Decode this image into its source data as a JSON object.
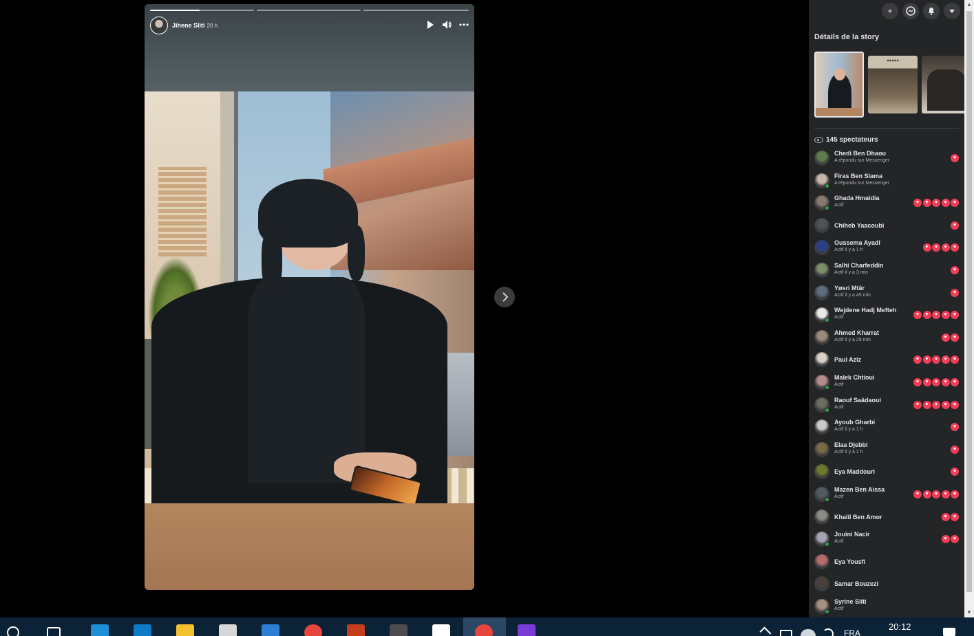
{
  "story": {
    "author": "Jihene Sliti",
    "time": "20 h",
    "progress": [
      1,
      0.48,
      0,
      0
    ],
    "segments_count": 3,
    "play_icon": "play-icon",
    "volume_icon": "volume-icon",
    "more_icon": "more-icon"
  },
  "navigation": {
    "next_icon": "chevron-right-icon"
  },
  "panel": {
    "top_icons": [
      "plus-icon",
      "messenger-icon",
      "bell-icon",
      "caret-down-icon"
    ],
    "title": "Détails de la story",
    "viewers_count": "145 spectateurs",
    "thumb_text": "♥♥♥♥♥",
    "viewers": [
      {
        "name": "Chedi Ben Dhaou",
        "status": "A répondu sur Messenger",
        "hearts": 1,
        "online": false
      },
      {
        "name": "Firas Ben Slama",
        "status": "A répondu sur Messenger",
        "hearts": 0,
        "online": true
      },
      {
        "name": "Ghada Hmaidia",
        "status": "Actif",
        "hearts": 5,
        "online": true
      },
      {
        "name": "Chiheb Yaacoubi",
        "status": "",
        "hearts": 1,
        "online": false
      },
      {
        "name": "Oussema Ayadi",
        "status": "Actif il y a 1 h",
        "hearts": 4,
        "online": false
      },
      {
        "name": "Salhi Charfeddin",
        "status": "Actif il y a 3 min",
        "hearts": 1,
        "online": false
      },
      {
        "name": "Yøsri Mtâr",
        "status": "Actif il y a 45 min",
        "hearts": 1,
        "online": false
      },
      {
        "name": "Wejdene Hadj Mefteh",
        "status": "Actif",
        "hearts": 5,
        "online": true
      },
      {
        "name": "Ahmed Kharrat",
        "status": "Actif il y a 29 min",
        "hearts": 2,
        "online": false
      },
      {
        "name": "Paul Aziz",
        "status": "",
        "hearts": 5,
        "online": false
      },
      {
        "name": "Malek Chtioui",
        "status": "Actif",
        "hearts": 5,
        "online": true
      },
      {
        "name": "Raouf Saâdaoui",
        "status": "Actif",
        "hearts": 5,
        "online": true
      },
      {
        "name": "Ayoub Gharbi",
        "status": "Actif il y a 1 h",
        "hearts": 1,
        "online": false
      },
      {
        "name": "Elaa Djebbi",
        "status": "Actif il y a 1 h",
        "hearts": 1,
        "online": false
      },
      {
        "name": "Eya Maddouri",
        "status": "",
        "hearts": 1,
        "online": false
      },
      {
        "name": "Mazen Ben Aissa",
        "status": "Actif",
        "hearts": 5,
        "online": true
      },
      {
        "name": "Khalil Ben Amor",
        "status": "",
        "hearts": 2,
        "online": false
      },
      {
        "name": "Jouini Nacir",
        "status": "Actif",
        "hearts": 2,
        "online": true
      },
      {
        "name": "Eya Yousfi",
        "status": "",
        "hearts": 0,
        "online": false
      },
      {
        "name": "Samar Bouzezi",
        "status": "",
        "hearts": 0,
        "online": false
      },
      {
        "name": "Syrine Sliti",
        "status": "Actif",
        "hearts": 0,
        "online": true
      }
    ]
  },
  "taskbar": {
    "clock": "20:12",
    "language": "FRA",
    "apps": [
      "search-icon",
      "task-view-icon",
      "internet-explorer-icon",
      "edge-icon",
      "file-explorer-icon",
      "store-icon",
      "mail-icon",
      "chrome-icon",
      "powerpoint-icon",
      "sublime-icon",
      "document-icon",
      "chrome-active-icon",
      "phpstorm-icon"
    ]
  },
  "colors": {
    "panel_bg": "#242526",
    "heart": "#f33e58",
    "online": "#31a24c",
    "taskbar": "#0b2237"
  }
}
